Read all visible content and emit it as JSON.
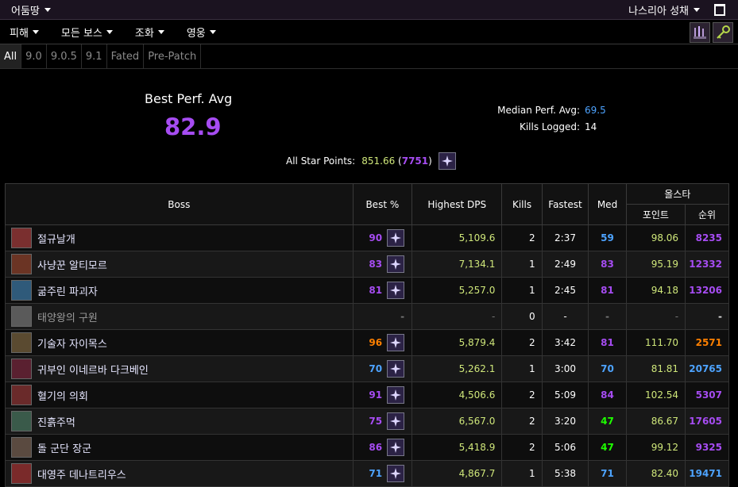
{
  "topbar": {
    "region": "어둠땅",
    "raid": "나스리아 성채"
  },
  "menu": [
    "피해",
    "모든 보스",
    "조화",
    "영웅"
  ],
  "tabs": [
    "All",
    "9.0",
    "9.0.5",
    "9.1",
    "Fated",
    "Pre-Patch"
  ],
  "summary": {
    "best_perf_label": "Best Perf. Avg",
    "best_perf_value": "82.9",
    "median_label": "Median Perf. Avg:",
    "median_value": "69.5",
    "kills_label": "Kills Logged:",
    "kills_value": "14",
    "star_label": "All Star Points:",
    "star_points": "851.66",
    "star_rank": "7751",
    "open_paren": "(",
    "close_paren": ")"
  },
  "table": {
    "headers": {
      "boss": "Boss",
      "best": "Best %",
      "dps": "Highest DPS",
      "kills": "Kills",
      "fastest": "Fastest",
      "med": "Med",
      "allstar": "올스타",
      "points": "포인트",
      "rank": "순위"
    },
    "rows": [
      {
        "boss": "절규날개",
        "best": "90",
        "dps": "5,109.6",
        "kills": "2",
        "fastest": "2:37",
        "med": "59",
        "points": "98.06",
        "rank": "8235",
        "c_best": "#a64cf2",
        "c_med": "#4da3ff",
        "c_rank": "#a64cf2",
        "icon": "#7a2f2f"
      },
      {
        "boss": "사냥꾼 알티모르",
        "best": "83",
        "dps": "7,134.1",
        "kills": "1",
        "fastest": "2:49",
        "med": "83",
        "points": "95.19",
        "rank": "12332",
        "c_best": "#a64cf2",
        "c_med": "#a64cf2",
        "c_rank": "#a64cf2",
        "icon": "#6b3424"
      },
      {
        "boss": "굶주린 파괴자",
        "best": "81",
        "dps": "5,257.0",
        "kills": "1",
        "fastest": "2:45",
        "med": "81",
        "points": "94.18",
        "rank": "13206",
        "c_best": "#a64cf2",
        "c_med": "#a64cf2",
        "c_rank": "#a64cf2",
        "icon": "#2f5a7a"
      },
      {
        "boss": "태양왕의 구원",
        "best": "-",
        "dps": "-",
        "kills": "0",
        "fastest": "-",
        "med": "-",
        "points": "-",
        "rank": "-",
        "c_best": "#777",
        "c_med": "#777",
        "c_rank": "#ddd",
        "icon": "#5a5a5a",
        "dim": true
      },
      {
        "boss": "기술자 자이목스",
        "best": "96",
        "dps": "5,879.4",
        "kills": "2",
        "fastest": "3:42",
        "med": "81",
        "points": "111.70",
        "rank": "2571",
        "c_best": "#ff8000",
        "c_med": "#a64cf2",
        "c_rank": "#ff8000",
        "icon": "#5a4a30"
      },
      {
        "boss": "귀부인 이네르바 다크베인",
        "best": "70",
        "dps": "5,262.1",
        "kills": "1",
        "fastest": "3:00",
        "med": "70",
        "points": "81.81",
        "rank": "20765",
        "c_best": "#4da3ff",
        "c_med": "#4da3ff",
        "c_rank": "#4da3ff",
        "icon": "#5a2030"
      },
      {
        "boss": "혈기의 의회",
        "best": "91",
        "dps": "4,506.6",
        "kills": "2",
        "fastest": "5:09",
        "med": "84",
        "points": "102.54",
        "rank": "5307",
        "c_best": "#a64cf2",
        "c_med": "#a64cf2",
        "c_rank": "#a64cf2",
        "icon": "#6a2a2a"
      },
      {
        "boss": "진흙주먹",
        "best": "75",
        "dps": "6,567.0",
        "kills": "2",
        "fastest": "3:20",
        "med": "47",
        "points": "86.67",
        "rank": "17605",
        "c_best": "#a64cf2",
        "c_med": "#1eff00",
        "c_rank": "#a64cf2",
        "icon": "#3a5a4a"
      },
      {
        "boss": "돌 군단 장군",
        "best": "86",
        "dps": "5,418.9",
        "kills": "2",
        "fastest": "5:06",
        "med": "47",
        "points": "99.12",
        "rank": "9325",
        "c_best": "#a64cf2",
        "c_med": "#1eff00",
        "c_rank": "#a64cf2",
        "icon": "#5a4a40"
      },
      {
        "boss": "대영주 데나트리우스",
        "best": "71",
        "dps": "4,867.7",
        "kills": "1",
        "fastest": "5:38",
        "med": "71",
        "points": "82.40",
        "rank": "19471",
        "c_best": "#4da3ff",
        "c_med": "#4da3ff",
        "c_rank": "#4da3ff",
        "icon": "#7a2a2a"
      }
    ]
  }
}
